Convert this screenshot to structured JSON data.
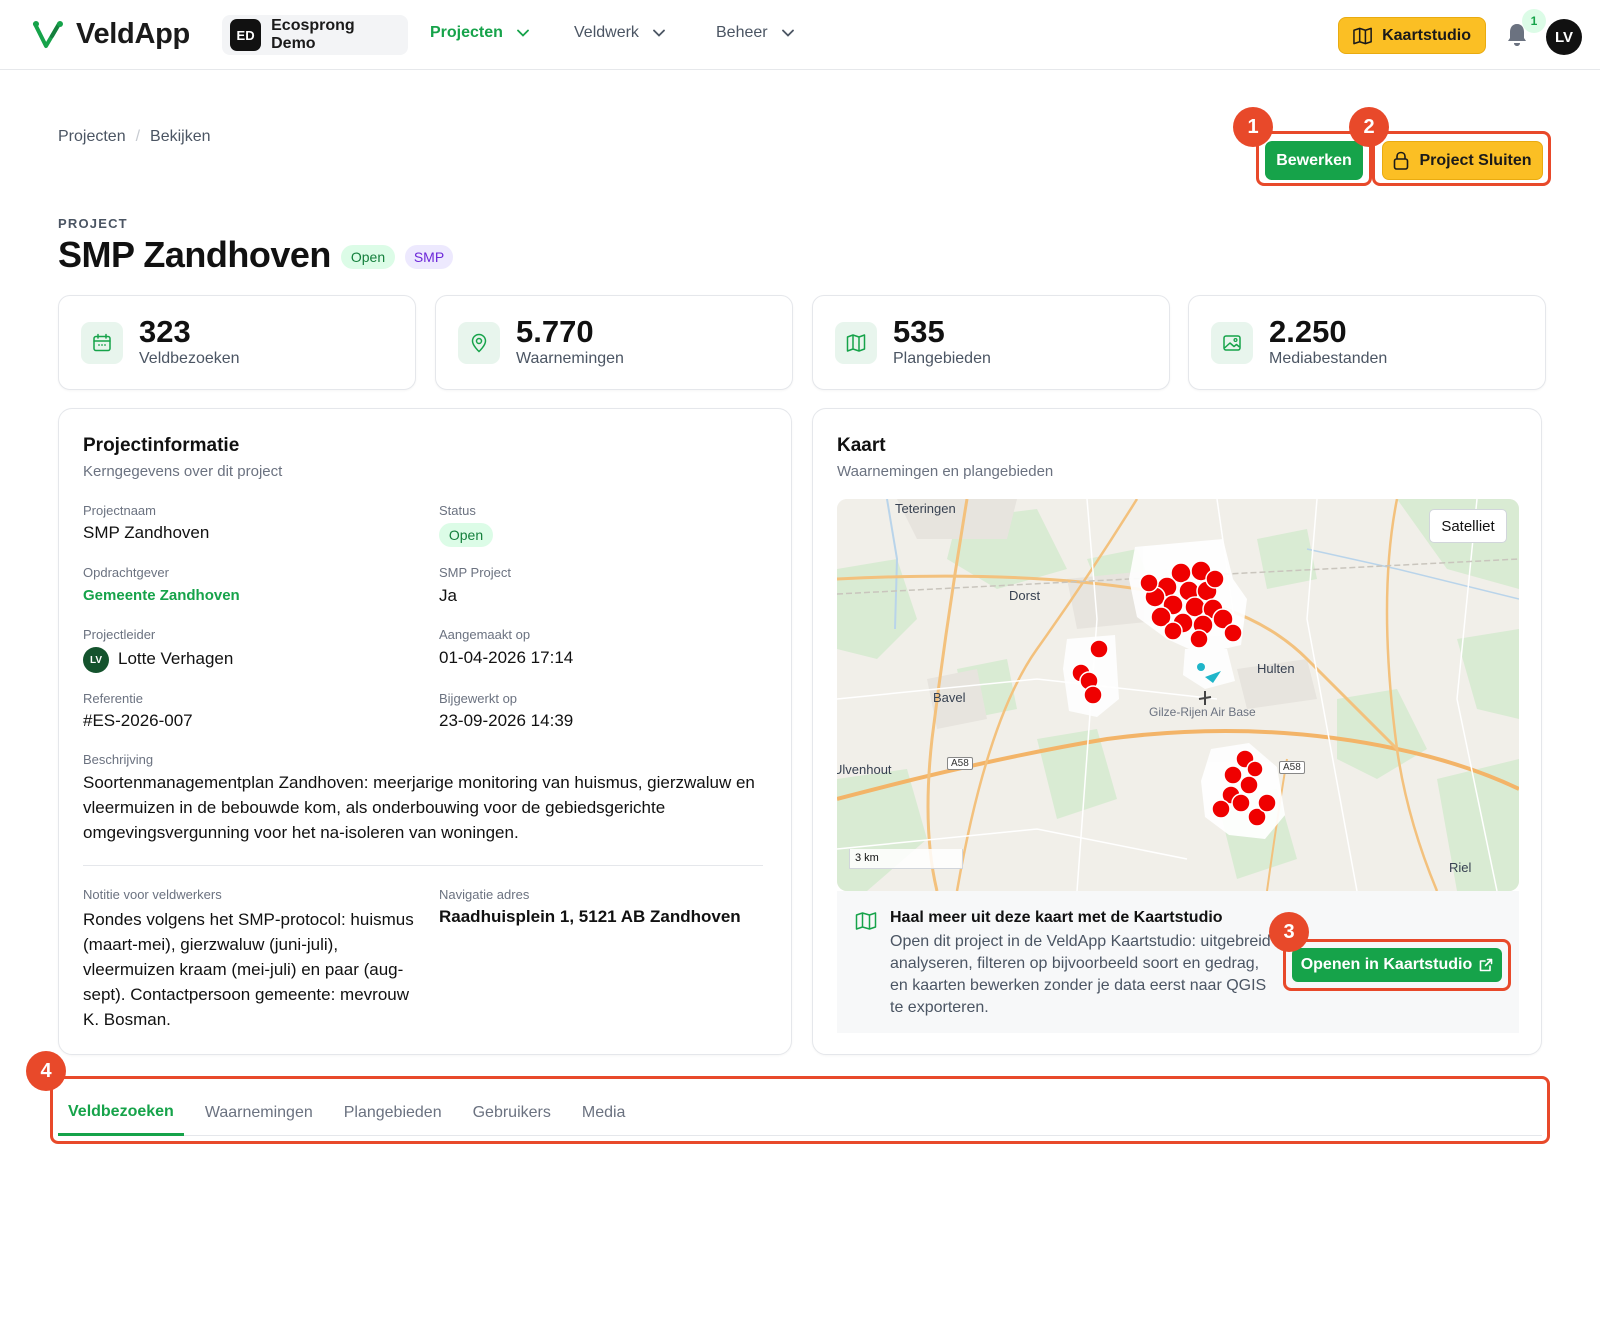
{
  "app": {
    "name": "VeldApp"
  },
  "org": {
    "initials": "ED",
    "name": "Ecosprong Demo"
  },
  "nav": [
    {
      "label": "Projecten",
      "active": true
    },
    {
      "label": "Veldwerk",
      "active": false
    },
    {
      "label": "Beheer",
      "active": false
    }
  ],
  "header": {
    "kaartstudio_label": "Kaartstudio",
    "notification_count": "1",
    "user_initials": "LV"
  },
  "breadcrumb": [
    "Projecten",
    "Bekijken"
  ],
  "actions": {
    "edit_label": "Bewerken",
    "close_label": "Project Sluiten"
  },
  "annotations": [
    "1",
    "2",
    "3",
    "4"
  ],
  "project": {
    "eyebrow": "PROJECT",
    "title": "SMP Zandhoven",
    "badges": [
      "Open",
      "SMP"
    ]
  },
  "stats": [
    {
      "value": "323",
      "label": "Veldbezoeken",
      "icon": "calendar-icon"
    },
    {
      "value": "5.770",
      "label": "Waarnemingen",
      "icon": "map-pin-icon"
    },
    {
      "value": "535",
      "label": "Plangebieden",
      "icon": "map-icon"
    },
    {
      "value": "2.250",
      "label": "Mediabestanden",
      "icon": "image-icon"
    }
  ],
  "info": {
    "title": "Projectinformatie",
    "subtitle": "Kerngegevens over dit project",
    "fields": {
      "projectnaam": {
        "label": "Projectnaam",
        "value": "SMP Zandhoven"
      },
      "status": {
        "label": "Status",
        "value": "Open"
      },
      "opdrachtgever": {
        "label": "Opdrachtgever",
        "value": "Gemeente Zandhoven"
      },
      "smp": {
        "label": "SMP Project",
        "value": "Ja"
      },
      "projectleider": {
        "label": "Projectleider",
        "value": "Lotte Verhagen",
        "initials": "LV"
      },
      "aangemaakt": {
        "label": "Aangemaakt op",
        "value": "01-04-2026 17:14"
      },
      "referentie": {
        "label": "Referentie",
        "value": "#ES-2026-007"
      },
      "bijgewerkt": {
        "label": "Bijgewerkt op",
        "value": "23-09-2026 14:39"
      },
      "beschrijving": {
        "label": "Beschrijving",
        "value": "Soortenmanagementplan Zandhoven: meerjarige monitoring van huismus, gierzwaluw en vleermuizen in de bebouwde kom, als onderbouwing voor de gebiedsgerichte omgevingsvergunning voor het na-isoleren van woningen."
      },
      "notitie": {
        "label": "Notitie voor veldwerkers",
        "value": "Rondes volgens het SMP-protocol: huismus (maart-mei), gierzwaluw (juni-juli), vleermuizen kraam (mei-juli) en paar (aug-sept). Contactpersoon gemeente: mevrouw K. Bosman."
      },
      "navigatie": {
        "label": "Navigatie adres",
        "value": "Raadhuisplein 1, 5121 AB Zandhoven"
      }
    }
  },
  "map": {
    "title": "Kaart",
    "subtitle": "Waarnemingen en plangebieden",
    "toggle_label": "Satelliet",
    "scale_label": "3 km",
    "places": [
      "Teteringen",
      "Dorst",
      "Hulten",
      "Bavel",
      "Gilze-Rijen Air Base",
      "Ulvenhout",
      "Riel"
    ],
    "roads": [
      "A58",
      "A58"
    ],
    "promo": {
      "title": "Haal meer uit deze kaart met de Kaartstudio",
      "text": "Open dit project in de VeldApp Kaartstudio: uitgebreid analyseren, filteren op bijvoorbeeld soort en gedrag, en kaarten bewerken zonder je data eerst naar QGIS te exporteren.",
      "button_label": "Openen in Kaartstudio"
    }
  },
  "tabs": [
    {
      "label": "Veldbezoeken",
      "active": true
    },
    {
      "label": "Waarnemingen",
      "active": false
    },
    {
      "label": "Plangebieden",
      "active": false
    },
    {
      "label": "Gebruikers",
      "active": false
    },
    {
      "label": "Media",
      "active": false
    }
  ],
  "colors": {
    "brand_green": "#16a34a",
    "accent_yellow": "#fbbf24",
    "highlight_red": "#e8492a",
    "marker_red": "#ef0000"
  }
}
